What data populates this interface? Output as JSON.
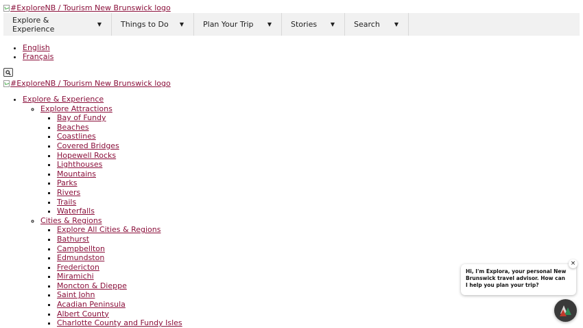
{
  "logo": {
    "alt": "#ExploreNB / Tourism New Brunswick logo"
  },
  "nav": [
    {
      "label": "Explore & Experience"
    },
    {
      "label": "Things to Do"
    },
    {
      "label": "Plan Your Trip"
    },
    {
      "label": "Stories"
    },
    {
      "label": "Search"
    }
  ],
  "languages": [
    "English",
    "Français"
  ],
  "menu": {
    "top": "Explore & Experience",
    "sections": [
      {
        "title": "Explore Attractions",
        "items": [
          "Bay of Fundy",
          "Beaches",
          "Coastlines",
          "Covered Bridges",
          "Hopewell Rocks",
          "Lighthouses",
          "Mountains",
          "Parks",
          "Rivers",
          "Trails",
          "Waterfalls"
        ]
      },
      {
        "title": "Cities & Regions",
        "items": [
          "Explore All Cities & Regions",
          "Bathurst",
          "Campbellton",
          "Edmundston",
          "Fredericton",
          "Miramichi",
          "Moncton & Dieppe",
          "Saint John",
          "Acadian Peninsula",
          "Albert County",
          "Charlotte County and Fundy Isles"
        ]
      }
    ]
  },
  "chat": {
    "message": "Hi, I'm Explora, your personal New Brunswick travel advisor. How can I help you plan your trip?",
    "close_glyph": "×"
  },
  "colors": {
    "link": "#8a0f3a",
    "nav_bg": "#f1f1f1",
    "launcher_bg": "#3a3a3a"
  },
  "icons": {
    "search": "search-icon",
    "caret": "caret-down-icon",
    "close": "close-icon",
    "launcher": "explora-trees-icon"
  }
}
